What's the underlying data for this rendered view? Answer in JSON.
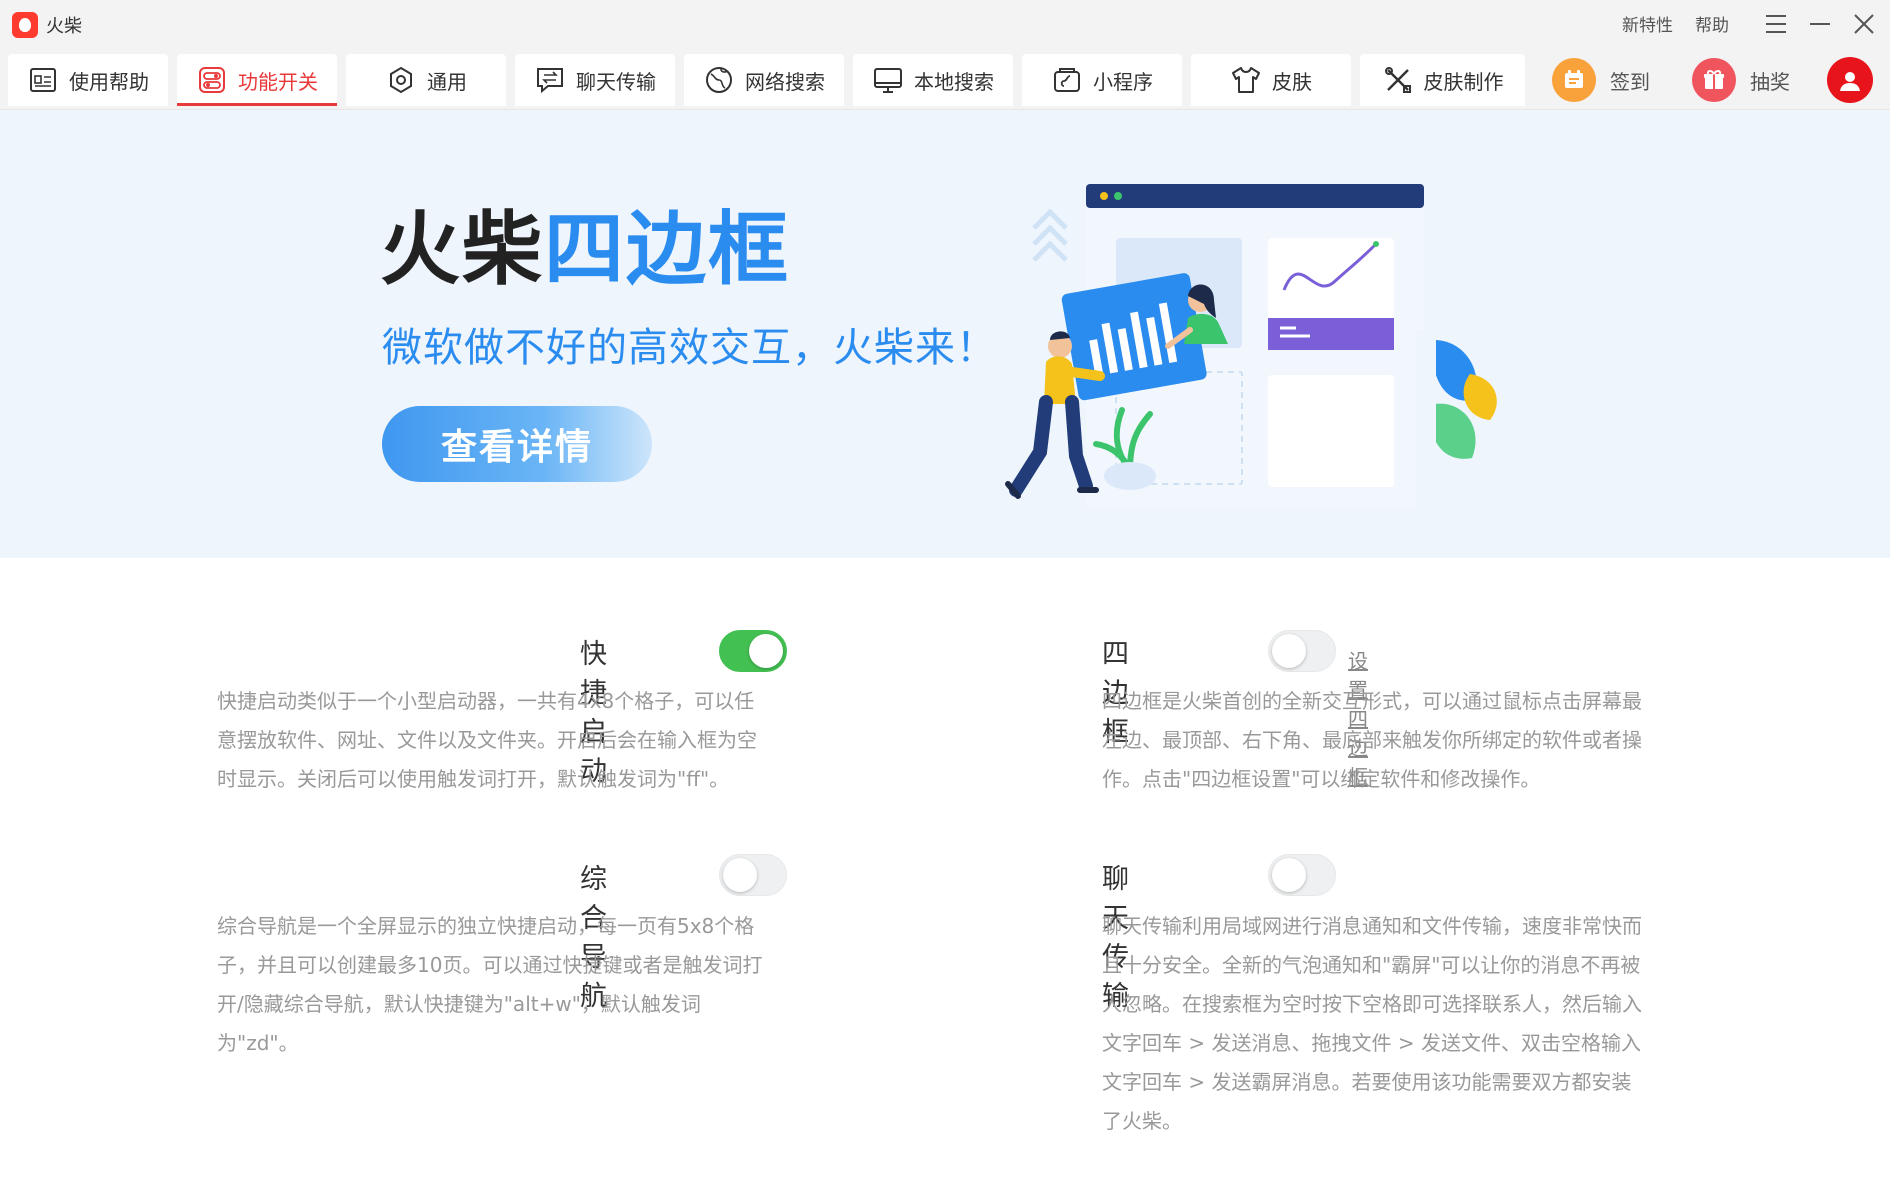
{
  "window": {
    "title": "火柴",
    "links": [
      "新特性",
      "帮助"
    ],
    "controls": [
      "menu-icon",
      "minimize-icon",
      "close-icon"
    ]
  },
  "tabs": [
    {
      "label": "使用帮助",
      "icon": "help-doc-icon",
      "active": false
    },
    {
      "label": "功能开关",
      "icon": "switch-icon",
      "active": true
    },
    {
      "label": "通用",
      "icon": "hexagon-gear-icon",
      "active": false
    },
    {
      "label": "聊天传输",
      "icon": "chat-transfer-icon",
      "active": false
    },
    {
      "label": "网络搜索",
      "icon": "globe-search-icon",
      "active": false
    },
    {
      "label": "本地搜索",
      "icon": "monitor-icon",
      "active": false
    },
    {
      "label": "小程序",
      "icon": "mini-program-icon",
      "active": false
    },
    {
      "label": "皮肤",
      "icon": "shirt-icon",
      "active": false
    },
    {
      "label": "皮肤制作",
      "icon": "tools-icon",
      "active": false
    }
  ],
  "actions": {
    "checkin_label": "签到",
    "lottery_label": "抽奖"
  },
  "banner": {
    "title_dark": "火柴",
    "title_blue": "四边框",
    "subtitle": "微软做不好的高效交互，火柴来！",
    "button_label": "查看详情"
  },
  "features": {
    "quick_launch": {
      "title": "快捷启动",
      "enabled": true,
      "desc": [
        "快捷启动类似于一个小型启动器，一共有4x8个格子，可以任",
        "意摆放软件、网址、文件以及文件夹。开启后会在输入框为空",
        "时显示。关闭后可以使用触发词打开，默认触发词为\"ff\"。"
      ]
    },
    "four_edge": {
      "title": "四边框",
      "enabled": false,
      "link": "设置四边框",
      "desc": [
        "四边框是火柴首创的全新交互形式，可以通过鼠标点击屏幕最",
        "左边、最顶部、右下角、最底部来触发你所绑定的软件或者操",
        "作。点击\"四边框设置\"可以绑定软件和修改操作。"
      ]
    },
    "navigation": {
      "title": "综合导航",
      "enabled": false,
      "desc": [
        "综合导航是一个全屏显示的独立快捷启动，每一页有5x8个格",
        "子，并且可以创建最多10页。可以通过快捷键或者是触发词打",
        "开/隐藏综合导航，默认快捷键为\"alt+w\"，默认触发词",
        "为\"zd\"。"
      ]
    },
    "chat_transfer": {
      "title": "聊天传输",
      "enabled": false,
      "desc": [
        "聊天传输利用局域网进行消息通知和文件传输，速度非常快而",
        "且十分安全。全新的气泡通知和\"霸屏\"可以让你的消息不再被",
        "人忽略。在搜索框为空时按下空格即可选择联系人，然后输入",
        "文字回车 > 发送消息、拖拽文件 > 发送文件、双击空格输入",
        "文字回车 > 发送霸屏消息。若要使用该功能需要双方都安装",
        "了火柴。"
      ]
    }
  },
  "colors": {
    "accent": "#e83a3a",
    "brand_blue": "#2b8cf0",
    "toggle_on": "#43c052"
  }
}
